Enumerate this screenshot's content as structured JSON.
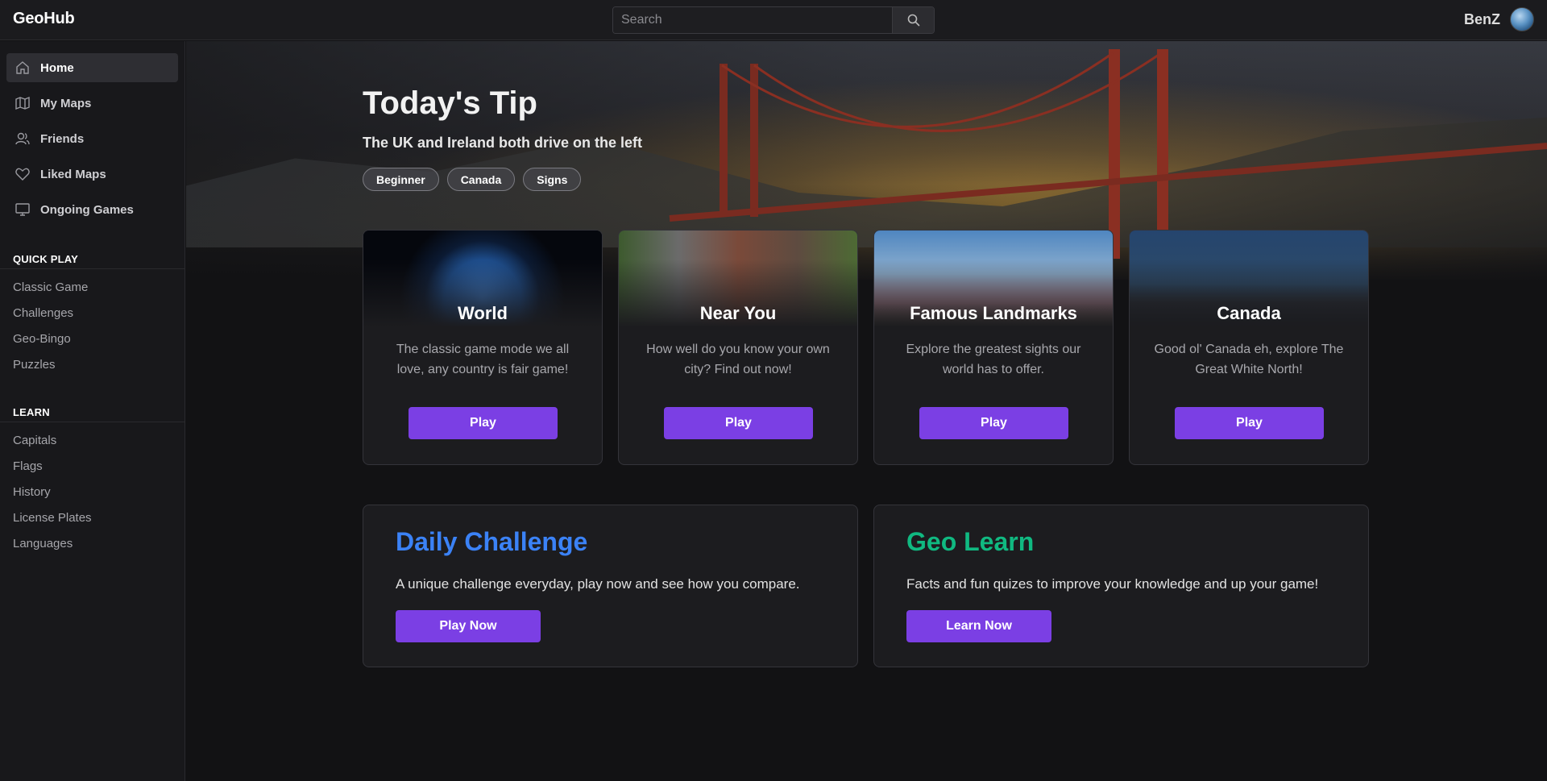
{
  "app": {
    "name": "GeoHub"
  },
  "search": {
    "placeholder": "Search"
  },
  "user": {
    "name": "BenZ"
  },
  "nav": {
    "items": [
      {
        "label": "Home",
        "icon": "home-icon",
        "active": true
      },
      {
        "label": "My Maps",
        "icon": "map-icon"
      },
      {
        "label": "Friends",
        "icon": "friends-icon"
      },
      {
        "label": "Liked Maps",
        "icon": "heart-icon"
      },
      {
        "label": "Ongoing Games",
        "icon": "monitor-icon"
      }
    ]
  },
  "quick_play": {
    "title": "QUICK PLAY",
    "items": [
      "Classic Game",
      "Challenges",
      "Geo-Bingo",
      "Puzzles"
    ]
  },
  "learn": {
    "title": "LEARN",
    "items": [
      "Capitals",
      "Flags",
      "History",
      "License Plates",
      "Languages"
    ]
  },
  "tip": {
    "title": "Today's Tip",
    "text": "The UK and Ireland both drive on the left",
    "tags": [
      "Beginner",
      "Canada",
      "Signs"
    ]
  },
  "modes": [
    {
      "title": "World",
      "description": "The classic game mode we all love, any country is fair game!",
      "button": "Play"
    },
    {
      "title": "Near You",
      "description": "How well do you know your own city? Find out now!",
      "button": "Play"
    },
    {
      "title": "Famous Landmarks",
      "description": "Explore the greatest sights our world has to offer.",
      "button": "Play"
    },
    {
      "title": "Canada",
      "description": "Good ol' Canada eh, explore The Great White North!",
      "button": "Play"
    }
  ],
  "features": [
    {
      "title": "Daily Challenge",
      "text": "A unique challenge everyday, play now and see how you compare.",
      "button": "Play Now",
      "color": "#3b82f6"
    },
    {
      "title": "Geo Learn",
      "text": "Facts and fun quizes to improve your knowledge and up your game!",
      "button": "Learn Now",
      "color": "#10b981"
    }
  ],
  "colors": {
    "accent": "#7b3fe4",
    "background": "#121214",
    "surface": "#1c1c1f"
  }
}
